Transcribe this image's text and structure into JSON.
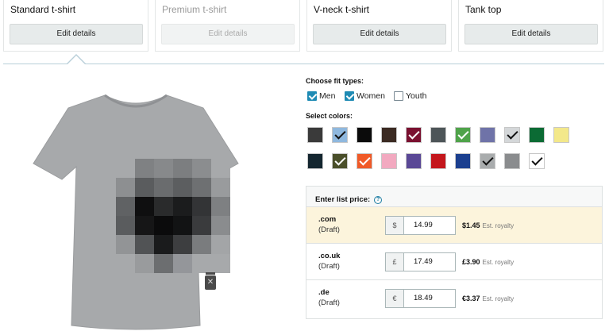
{
  "product_types": [
    {
      "title": "Standard t-shirt",
      "button": "Edit details",
      "enabled": true
    },
    {
      "title": "Premium t-shirt",
      "button": "Edit details",
      "enabled": false
    },
    {
      "title": "V-neck t-shirt",
      "button": "Edit details",
      "enabled": true
    },
    {
      "title": "Tank top",
      "button": "Edit details",
      "enabled": true
    }
  ],
  "fit_types": {
    "label": "Choose fit types:",
    "options": [
      {
        "label": "Men",
        "checked": true
      },
      {
        "label": "Women",
        "checked": true
      },
      {
        "label": "Youth",
        "checked": false
      }
    ]
  },
  "colors": {
    "label": "Select colors:",
    "swatches": [
      {
        "color": "#3a3a3a",
        "selected": false
      },
      {
        "color": "#8fb8de",
        "selected": true
      },
      {
        "color": "#0b0b0b",
        "selected": false
      },
      {
        "color": "#3b2a22",
        "selected": false
      },
      {
        "color": "#7a1030",
        "selected": true
      },
      {
        "color": "#4d5558",
        "selected": false
      },
      {
        "color": "#4fa34a",
        "selected": true
      },
      {
        "color": "#6f73a8",
        "selected": false
      },
      {
        "color": "#d4d7d9",
        "selected": true
      },
      {
        "color": "#0b6b34",
        "selected": false
      },
      {
        "color": "#f3e88a",
        "selected": false
      },
      {
        "color": "#142630",
        "selected": false
      },
      {
        "color": "#4a4f2a",
        "selected": true
      },
      {
        "color": "#f05a28",
        "selected": true
      },
      {
        "color": "#f2a9c0",
        "selected": false
      },
      {
        "color": "#5a4896",
        "selected": false
      },
      {
        "color": "#c4161c",
        "selected": false
      },
      {
        "color": "#1b3f8f",
        "selected": false
      },
      {
        "color": "#a9acad",
        "selected": true
      },
      {
        "color": "#8a8c8e",
        "selected": false
      },
      {
        "color": "#ffffff",
        "selected": true
      }
    ]
  },
  "pricing": {
    "label": "Enter list price:",
    "help_icon": "help-circle-icon",
    "rows": [
      {
        "marketplace": ".com",
        "status": "(Draft)",
        "currency": "$",
        "price": "14.99",
        "royalty": "$1.45",
        "royalty_label": "Est. royalty",
        "highlight": true
      },
      {
        "marketplace": ".co.uk",
        "status": "(Draft)",
        "currency": "£",
        "price": "17.49",
        "royalty": "£3.90",
        "royalty_label": "Est. royalty",
        "highlight": false
      },
      {
        "marketplace": ".de",
        "status": "(Draft)",
        "currency": "€",
        "price": "18.49",
        "royalty": "€3.37",
        "royalty_label": "Est. royalty",
        "highlight": false
      }
    ]
  },
  "preview": {
    "shirt_color": "#a7a9ab",
    "delete_icon": "trash-icon"
  }
}
